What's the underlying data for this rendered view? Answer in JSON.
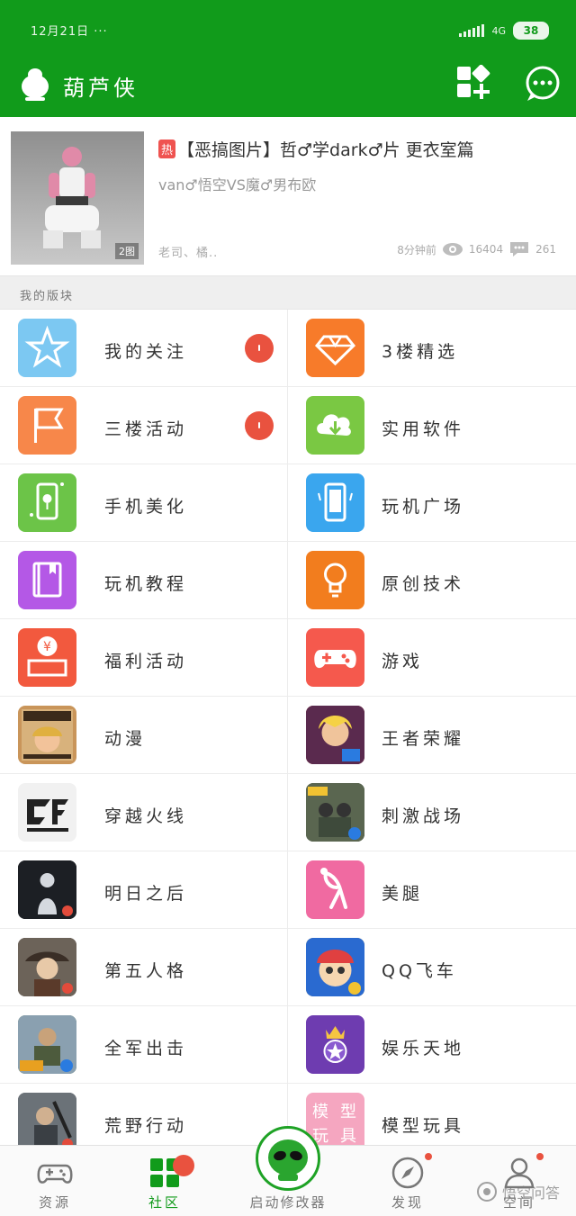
{
  "status_bar": {
    "time": "12月21日 ···",
    "network": "4G",
    "battery": "38"
  },
  "app_bar": {
    "title": "葫芦侠"
  },
  "featured_post": {
    "hot_tag": "热",
    "title": "【恶搞图片】哲♂学dark♂片 更衣室篇",
    "subtitle": "van♂悟空VS魔♂男布欧",
    "image_count": "2图",
    "author": "老司、橘..",
    "time": "8分钟前",
    "views": "16404",
    "comments": "261"
  },
  "section": {
    "title": "我的版块"
  },
  "boards": [
    {
      "label": "我的关注",
      "icon": "star-icon",
      "color": "#7cc8f2",
      "badge": true
    },
    {
      "label": "3楼精选",
      "icon": "diamond-icon",
      "color": "#f77b2a",
      "badge": false
    },
    {
      "label": "三楼活动",
      "icon": "flag-icon",
      "color": "#f7874a",
      "badge": true
    },
    {
      "label": "实用软件",
      "icon": "cloud-download-icon",
      "color": "#7ac843",
      "badge": false
    },
    {
      "label": "手机美化",
      "icon": "phone-flower-icon",
      "color": "#6cc448",
      "badge": false
    },
    {
      "label": "玩机广场",
      "icon": "phone-icon",
      "color": "#3aa6ee",
      "badge": false
    },
    {
      "label": "玩机教程",
      "icon": "book-icon",
      "color": "#b458e6",
      "badge": false
    },
    {
      "label": "原创技术",
      "icon": "bulb-icon",
      "color": "#f27d1e",
      "badge": false
    },
    {
      "label": "福利活动",
      "icon": "yen-gift-icon",
      "color": "#f2593e",
      "badge": false
    },
    {
      "label": "游戏",
      "icon": "gamepad-icon",
      "color": "#f5594d",
      "badge": false
    },
    {
      "label": "动漫",
      "icon": "wanted-poster-icon",
      "color": "#c9955a",
      "badge": false
    },
    {
      "label": "王者荣耀",
      "icon": "game-hero-icon",
      "color": "#b0402e",
      "badge": false
    },
    {
      "label": "穿越火线",
      "icon": "crossfire-logo-icon",
      "color": "#f1f1f1",
      "badge": false
    },
    {
      "label": "刺激战场",
      "icon": "pubg-icon",
      "color": "#4d5b49",
      "badge": false
    },
    {
      "label": "明日之后",
      "icon": "silhouette-icon",
      "color": "#23262b",
      "badge": false
    },
    {
      "label": "美腿",
      "icon": "pose-icon",
      "color": "#f06aa1",
      "badge": false
    },
    {
      "label": "第五人格",
      "icon": "identity-icon",
      "color": "#5a5047",
      "badge": false
    },
    {
      "label": "QQ飞车",
      "icon": "racer-icon",
      "color": "#f0b23a",
      "badge": false
    },
    {
      "label": "全军出击",
      "icon": "soldier-icon",
      "color": "#6b8c5c",
      "badge": false
    },
    {
      "label": "娱乐天地",
      "icon": "crown-star-icon",
      "color": "#6e3cb0",
      "badge": false
    },
    {
      "label": "荒野行动",
      "icon": "knives-out-icon",
      "color": "#7a7f84",
      "badge": false
    },
    {
      "label": "模型玩具",
      "icon": "model-toy-icon",
      "color": "#f5a6c0",
      "badge": false,
      "icon_text": "模型玩具"
    }
  ],
  "bottom_nav": {
    "resources": "资源",
    "community": "社区",
    "launcher": "启动修改器",
    "discover": "发现",
    "profile": "空间"
  },
  "watermark": "悟空问答",
  "colors": {
    "brand_green": "#119b1b",
    "badge_red": "#e9523f"
  }
}
